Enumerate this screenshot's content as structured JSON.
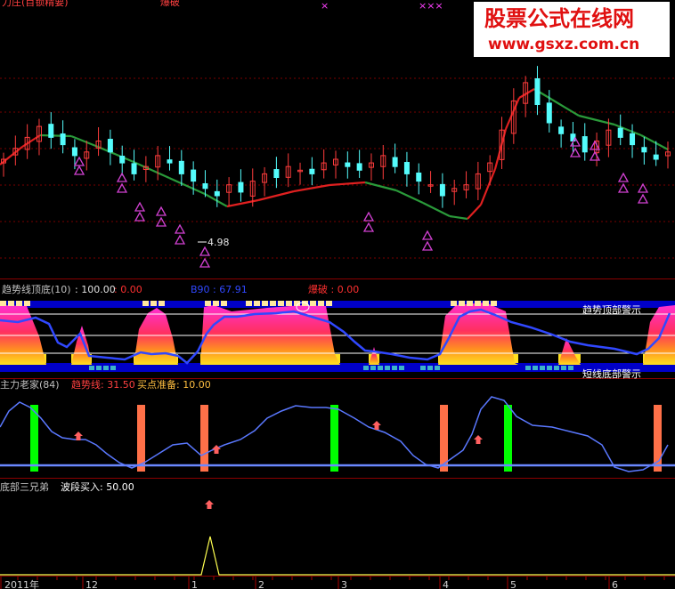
{
  "watermark": {
    "title": "股票公式在线网",
    "url": "www.gsxz.com.cn"
  },
  "main_chart": {
    "low_marker": "4.98"
  },
  "panel1": {
    "prefix": "趋势线顶底(10)",
    "value1": ": 100.00",
    "value2": ": 0.00",
    "label3": "B90 : 67.91",
    "label4": "爆破 : 0.00",
    "tag_top": "趋势顶部警示",
    "tag_bottom": "短线底部警示"
  },
  "panel2": {
    "title": "主力老家(84)",
    "series1": "趋势线: 31.50",
    "series2": "买点准备: 10.00"
  },
  "panel3": {
    "title": "底部三兄弟",
    "series1": "波段买入: 50.00"
  },
  "xaxis": {
    "labels": [
      "2011年",
      "12",
      "1",
      "2",
      "3",
      "4",
      "5",
      "6"
    ]
  },
  "colors": {
    "up": "#ff3c3c",
    "down": "#54fcfc",
    "ma_up": "#e02020",
    "ma_down": "#2a9a3a",
    "triangle": "#d040d0",
    "bar_green": "#00ff00",
    "bar_orange": "#ff7048",
    "line_blue": "#5a78ff",
    "blue_band": "#0000c8"
  },
  "chart_data": {
    "type": "candlestick",
    "ohlc_approx_close": [
      6.0,
      6.3,
      6.6,
      6.9,
      6.6,
      6.4,
      6.1,
      6.2,
      6.5,
      6.2,
      5.9,
      5.6,
      5.8,
      6.1,
      5.9,
      5.6,
      5.4,
      5.2,
      5.0,
      5.3,
      5.1,
      5.4,
      5.6,
      5.5,
      5.8,
      5.7,
      5.6,
      5.9,
      6.0,
      5.8,
      5.7,
      5.9,
      6.1,
      5.8,
      5.6,
      5.4,
      5.3,
      5.0,
      5.2,
      5.3,
      5.6,
      5.9,
      6.8,
      7.6,
      8.1,
      7.5,
      7.0,
      6.7,
      6.5,
      6.2,
      6.5,
      6.8,
      6.6,
      6.4,
      6.2,
      6.0,
      6.2
    ],
    "low_marker_value": 4.98,
    "panel1_values": {
      "line": 100.0,
      "base": 0.0,
      "B90": 67.91,
      "burst": 0.0
    },
    "panel2_values": {
      "trend": 31.5,
      "buy_ready": 10.0
    },
    "panel3_values": {
      "wave_buy": 50.0
    }
  }
}
